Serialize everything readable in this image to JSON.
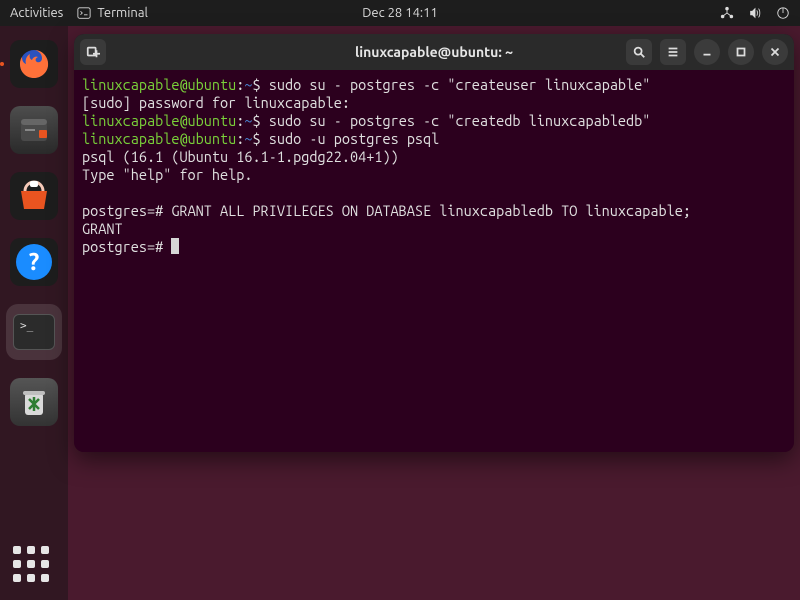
{
  "topbar": {
    "activities": "Activities",
    "terminal_label": "Terminal",
    "clock": "Dec 28  14:11"
  },
  "window": {
    "title": "linuxcapable@ubuntu: ~"
  },
  "terminal": {
    "prompt_user": "linuxcapable@ubuntu",
    "prompt_sep": ":",
    "prompt_path": "~",
    "prompt_symbol": "$",
    "lines": {
      "cmd1": " sudo su - postgres -c \"createuser linuxcapable\"",
      "sudo_prompt": "[sudo] password for linuxcapable:",
      "cmd2": " sudo su - postgres -c \"createdb linuxcapabledb\"",
      "cmd3": " sudo -u postgres psql",
      "psql_banner": "psql (16.1 (Ubuntu 16.1-1.pgdg22.04+1))",
      "psql_help": "Type \"help\" for help.",
      "pg_prompt": "postgres=#",
      "grant_cmd": " GRANT ALL PRIVILEGES ON DATABASE linuxcapabledb TO linuxcapable;",
      "grant_out": "GRANT"
    }
  }
}
